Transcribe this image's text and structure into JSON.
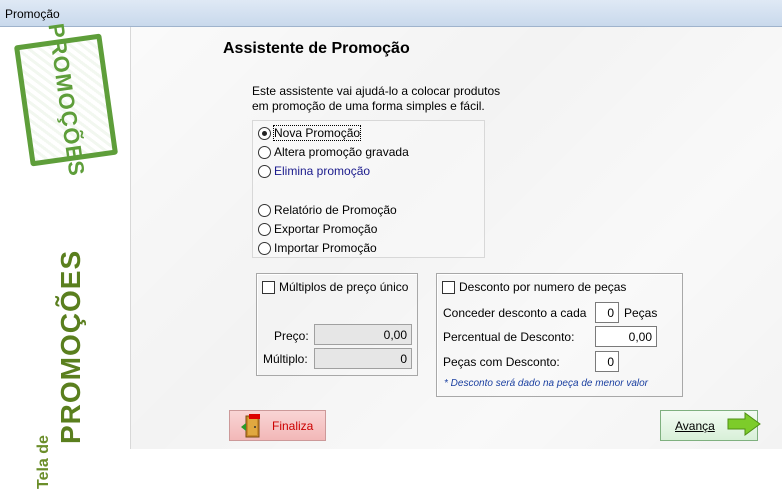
{
  "window": {
    "title": "Promoção"
  },
  "sidebar": {
    "stamp_text": "PROMOÇÕES",
    "title_small": "Tela de",
    "title_big": "PROMOÇÕES"
  },
  "wizard": {
    "heading": "Assistente de Promoção",
    "intro_line1": "Este assistente vai ajudá-lo a colocar produtos",
    "intro_line2": "em promoção de uma forma simples e fácil.",
    "options": [
      {
        "label": "Nova Promoção",
        "selected": true
      },
      {
        "label": "Altera promoção gravada",
        "selected": false
      },
      {
        "label": "Elimina promoção",
        "selected": false
      },
      {
        "label": "Relatório de Promoção",
        "selected": false
      },
      {
        "label": "Exportar Promoção",
        "selected": false
      },
      {
        "label": "Importar Promoção",
        "selected": false
      }
    ]
  },
  "multiplos": {
    "checkbox_label": "Múltiplos de preço único",
    "checked": false,
    "preco_label": "Preço:",
    "preco_value": "0,00",
    "multiplo_label": "Múltiplo:",
    "multiplo_value": "0"
  },
  "desconto": {
    "checkbox_label": "Desconto por numero de peças",
    "checked": false,
    "conceder_label": "Conceder desconto a cada",
    "conceder_value": "0",
    "pecas_suffix": "Peças",
    "percentual_label": "Percentual de Desconto:",
    "percentual_value": "0,00",
    "pecas_com_label": "Peças com Desconto:",
    "pecas_com_value": "0",
    "note": "* Desconto será dado na peça de menor valor"
  },
  "buttons": {
    "finaliza_label": "Finaliza",
    "avanca_label": "Avança"
  },
  "colors": {
    "accent_green": "#5e9e3a",
    "finaliza_text": "#cc0000"
  }
}
